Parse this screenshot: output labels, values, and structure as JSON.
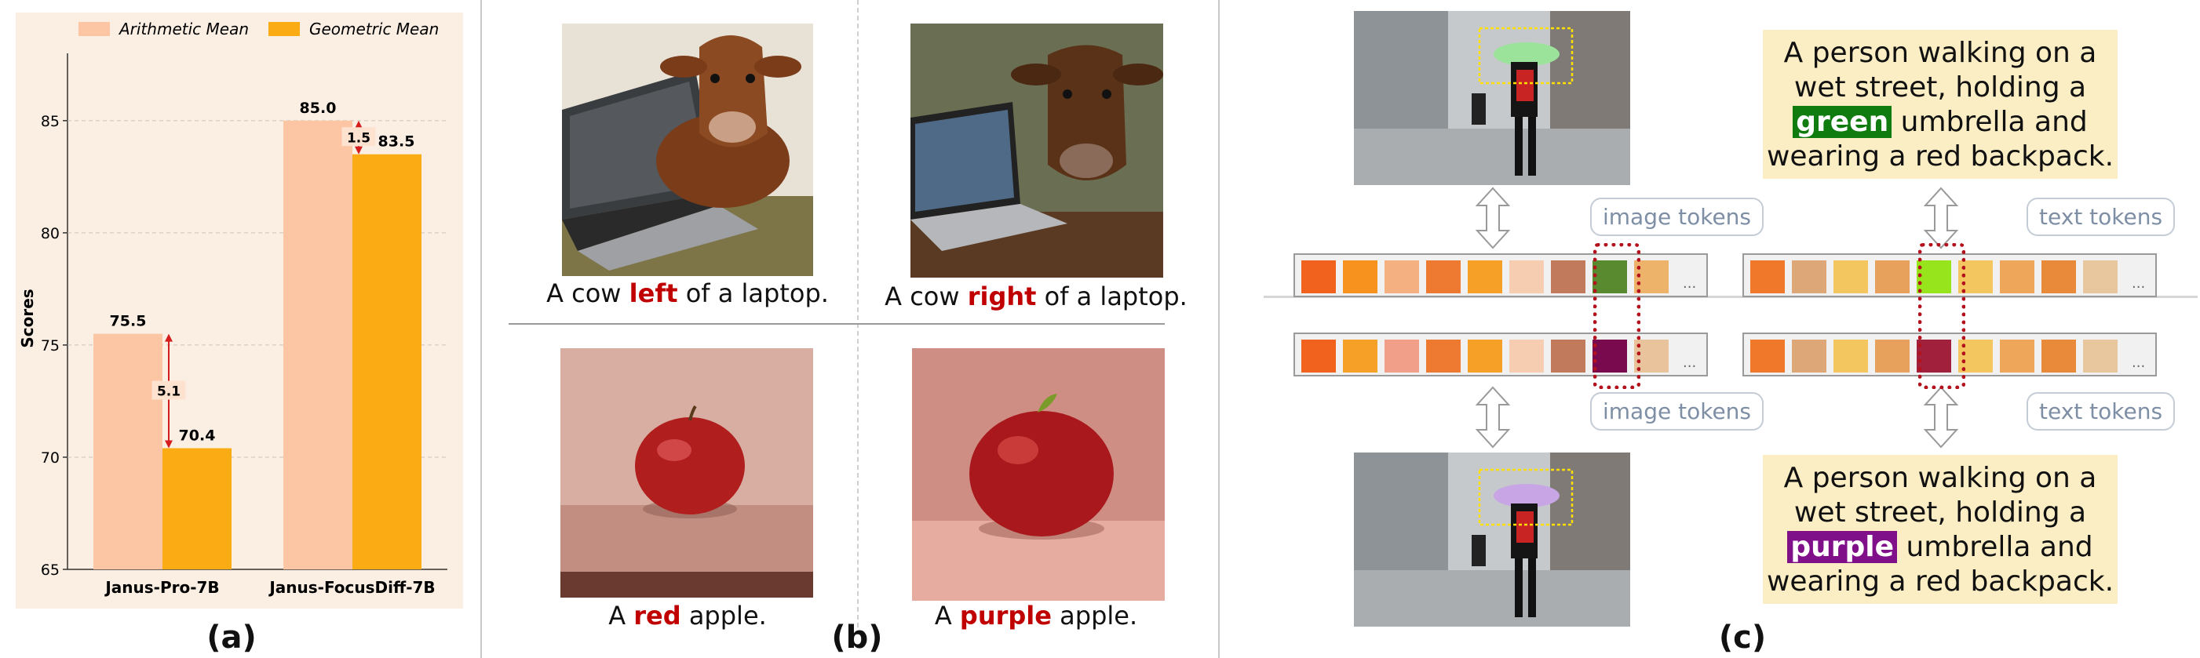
{
  "panels": {
    "a": "(a)",
    "b": "(b)",
    "c": "(c)"
  },
  "chart_data": {
    "type": "bar",
    "categories": [
      "Janus-Pro-7B",
      "Janus-FocusDiff-7B"
    ],
    "series": [
      {
        "name": "Arithmetic Mean",
        "values": [
          75.5,
          85.0
        ],
        "color": "#fcc6a5"
      },
      {
        "name": "Geometric Mean",
        "values": [
          70.4,
          83.5
        ],
        "color": "#fbab14"
      }
    ],
    "ylabel": "Scores",
    "ylim": [
      65,
      88
    ],
    "yticks": [
      65,
      70,
      75,
      80,
      85
    ],
    "grid": true,
    "legend": "top",
    "background": "#fbefe4",
    "annotations": [
      {
        "category": "Janus-Pro-7B",
        "text": "5.1"
      },
      {
        "category": "Janus-FocusDiff-7B",
        "text": "1.5"
      }
    ]
  },
  "panel_b": {
    "captions": [
      {
        "pre": "A cow ",
        "kw": "left",
        "post": " of a laptop."
      },
      {
        "pre": "A cow ",
        "kw": "right",
        "post": " of a laptop."
      },
      {
        "pre": "A ",
        "kw": "red",
        "post": " apple."
      },
      {
        "pre": "A ",
        "kw": "purple",
        "post": " apple."
      }
    ]
  },
  "panel_c": {
    "image_tokens_label": "image tokens",
    "text_tokens_label": "text tokens",
    "ellipsis": "...",
    "top_text": {
      "line1": "A person walking on a",
      "line2a": "wet street, holding a",
      "hl": "green",
      "line3b": " umbrella and",
      "line4": "wearing a red backpack."
    },
    "bottom_text": {
      "line1": "A person walking on a",
      "line2a": "wet street, holding a",
      "hl": "purple",
      "line3b": " umbrella and",
      "line4": "wearing a red backpack."
    },
    "colors": {
      "img_top": [
        "#f0621e",
        "#f7921e",
        "#f4b081",
        "#ee7a32",
        "#f7a028",
        "#f7cdb1",
        "#c27a5c",
        "#5a8a30",
        "#eeb36b"
      ],
      "img_bottom": [
        "#f0621e",
        "#f7a028",
        "#f29f8a",
        "#ee7a32",
        "#f7a028",
        "#f7cdb1",
        "#c27a5c",
        "#7a0a4e",
        "#e9c39b"
      ],
      "txt_top": [
        "#f0782a",
        "#dda777",
        "#f4c65f",
        "#e7a15c",
        "#98e41c",
        "#f4c65f",
        "#eea75a",
        "#e9893a",
        "#e8c79f"
      ],
      "txt_bottom": [
        "#f0782a",
        "#dda777",
        "#f4c65f",
        "#e7a15c",
        "#a1203c",
        "#f4c65f",
        "#eea75a",
        "#e9893a",
        "#e8c79f"
      ]
    }
  }
}
